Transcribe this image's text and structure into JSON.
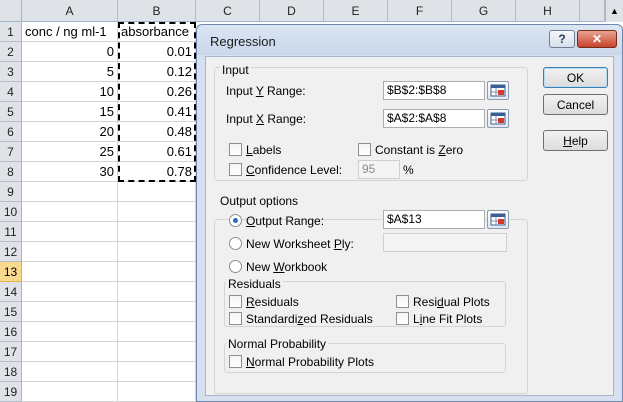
{
  "sheet": {
    "columns": [
      "A",
      "B",
      "C",
      "D",
      "E",
      "F",
      "G",
      "H"
    ],
    "rows": [
      "1",
      "2",
      "3",
      "4",
      "5",
      "6",
      "7",
      "8",
      "9",
      "10",
      "11",
      "12",
      "13",
      "14",
      "15",
      "16",
      "17",
      "18",
      "19"
    ],
    "selected_row": "13",
    "cells": {
      "A1": "conc / ng ml-1",
      "B1": "absorbance",
      "A2": "0",
      "B2": "0.01",
      "A3": "5",
      "B3": "0.12",
      "A4": "10",
      "B4": "0.26",
      "A5": "15",
      "B5": "0.41",
      "A6": "20",
      "B6": "0.48",
      "A7": "25",
      "B7": "0.61",
      "A8": "30",
      "B8": "0.78"
    }
  },
  "dialog": {
    "title": "Regression",
    "help_glyph": "?",
    "close_glyph": "✕",
    "input": {
      "group_label": "Input",
      "y_label_pre": "Input ",
      "y_label_u": "Y",
      "y_label_post": " Range:",
      "y_value": "$B$2:$B$8",
      "x_label_pre": "Input ",
      "x_label_u": "X",
      "x_label_post": " Range:",
      "x_value": "$A$2:$A$8",
      "labels_u": "L",
      "labels_rest": "abels",
      "constant_pre": "Constant is ",
      "constant_u": "Z",
      "constant_post": "ero",
      "confidence_u": "C",
      "confidence_rest": "onfidence Level:",
      "confidence_value": "95",
      "percent": "%"
    },
    "output": {
      "group_label": "Output options",
      "range_u": "O",
      "range_rest": "utput Range:",
      "range_value": "$A$13",
      "ply_pre": "New Worksheet ",
      "ply_u": "P",
      "ply_post": "ly:",
      "workbook_pre": "New ",
      "workbook_u": "W",
      "workbook_post": "orkbook"
    },
    "residuals": {
      "group_label": "Residuals",
      "residuals_u": "R",
      "residuals_rest": "esiduals",
      "standardized_pre": "Standardi",
      "standardized_u": "z",
      "standardized_post": "ed Residuals",
      "plots_pre": "Resi",
      "plots_u": "d",
      "plots_post": "ual Plots",
      "linefit_pre": "L",
      "linefit_u": "i",
      "linefit_post": "ne Fit Plots"
    },
    "normal": {
      "group_label": "Normal Probability",
      "plots_u": "N",
      "plots_rest": "ormal Probability Plots"
    },
    "buttons": {
      "ok": "OK",
      "cancel": "Cancel",
      "help_u": "H",
      "help_rest": "elp"
    }
  }
}
